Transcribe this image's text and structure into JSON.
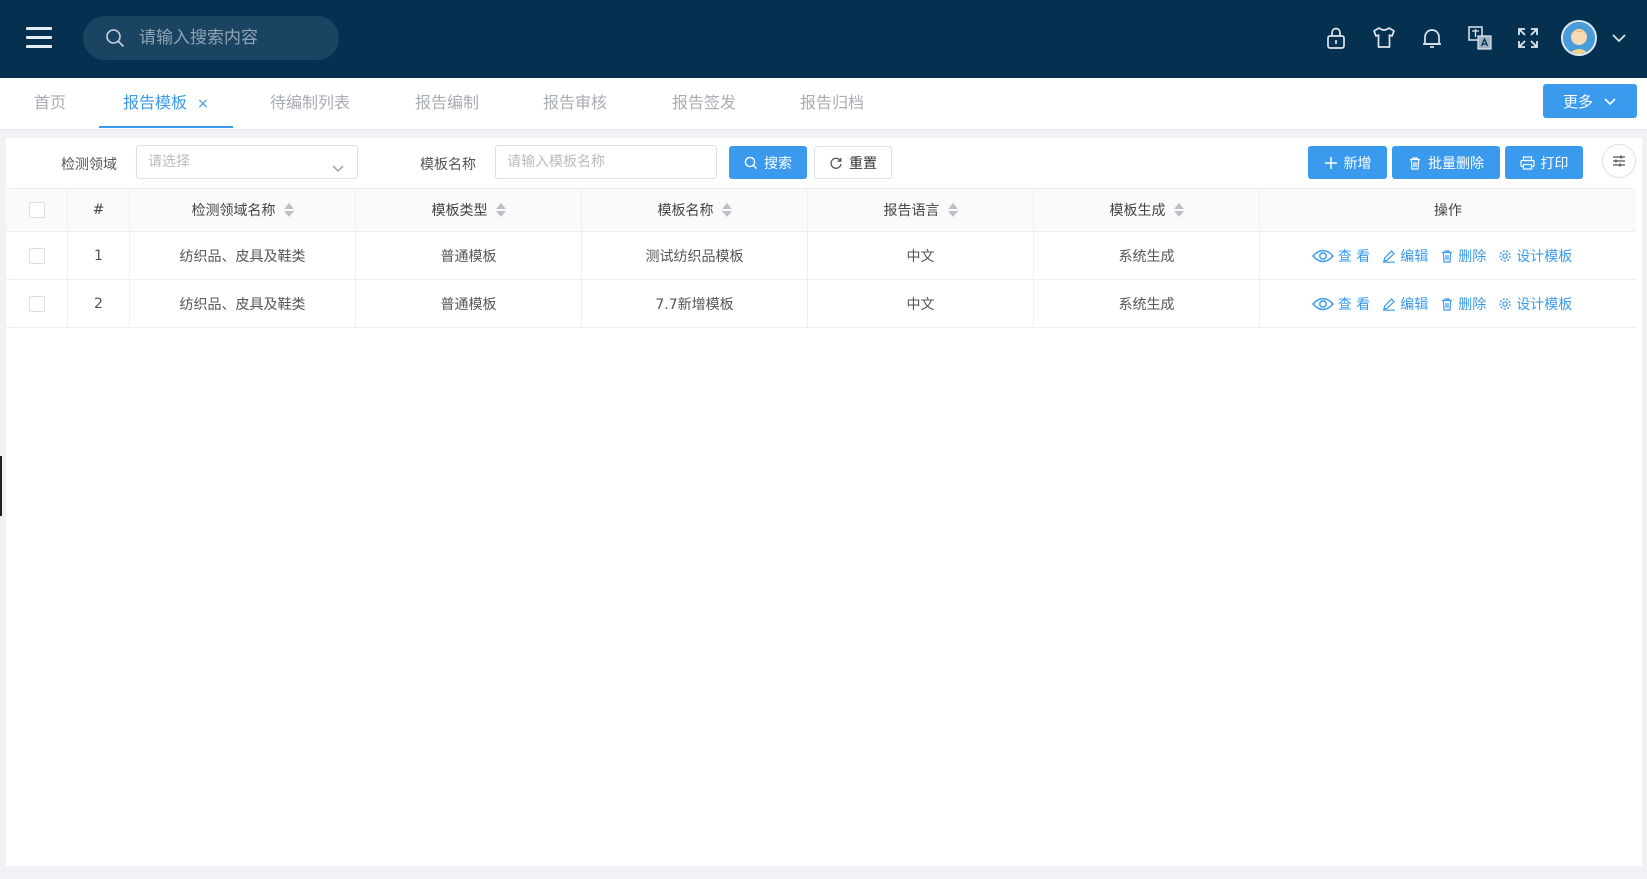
{
  "header": {
    "search_placeholder": "请输入搜索内容"
  },
  "tabs": [
    {
      "label": "首页",
      "active": false
    },
    {
      "label": "报告模板",
      "active": true,
      "closable": true
    },
    {
      "label": "待编制列表",
      "active": false
    },
    {
      "label": "报告编制",
      "active": false
    },
    {
      "label": "报告审核",
      "active": false
    },
    {
      "label": "报告签发",
      "active": false
    },
    {
      "label": "报告归档",
      "active": false
    }
  ],
  "tab_close": "×",
  "more_label": "更多",
  "filter": {
    "domain_label": "检测领域",
    "domain_placeholder": "请选择",
    "name_label": "模板名称",
    "name_placeholder": "请输入模板名称",
    "search_label": "搜索",
    "reset_label": "重置",
    "add_label": "新增",
    "batch_delete_label": "批量删除",
    "print_label": "打印"
  },
  "table": {
    "columns": [
      "#",
      "检测领域名称",
      "模板类型",
      "模板名称",
      "报告语言",
      "模板生成",
      "操作"
    ],
    "rows": [
      {
        "index": "1",
        "domain": "纺织品、皮具及鞋类",
        "type": "普通模板",
        "name": "测试纺织品模板",
        "language": "中文",
        "generate": "系统生成"
      },
      {
        "index": "2",
        "domain": "纺织品、皮具及鞋类",
        "type": "普通模板",
        "name": "7.7新增模板",
        "language": "中文",
        "generate": "系统生成"
      }
    ],
    "actions": {
      "view": "查 看",
      "edit": "编辑",
      "delete": "删除",
      "design": "设计模板"
    }
  },
  "colors": {
    "navbar": "#05304f",
    "primary": "#3a9aee"
  }
}
